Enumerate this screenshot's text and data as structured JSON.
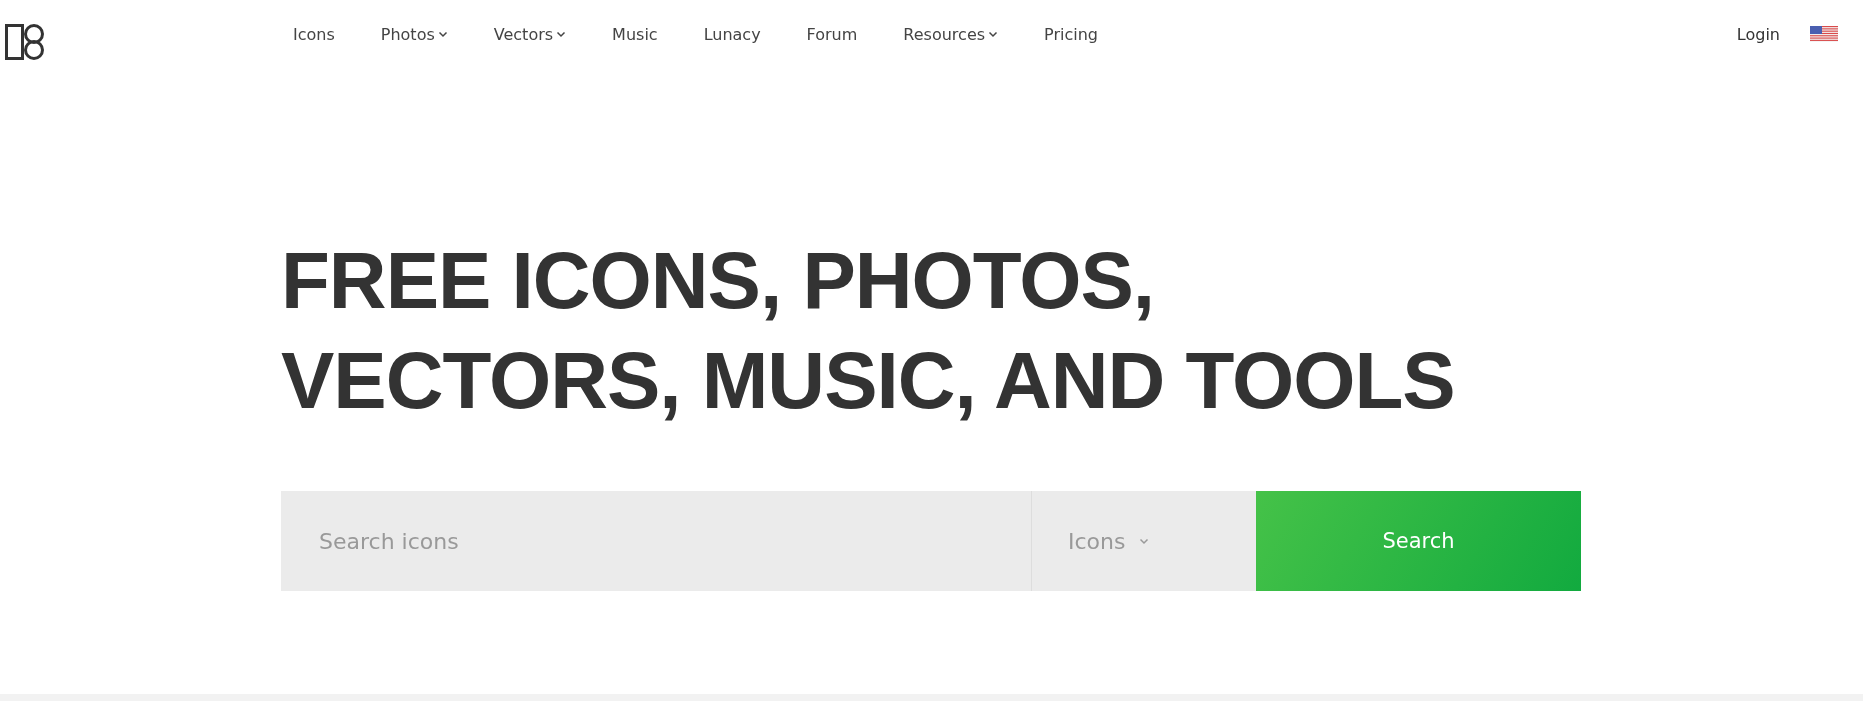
{
  "nav": [
    {
      "label": "Icons",
      "dropdown": false
    },
    {
      "label": "Photos",
      "dropdown": true
    },
    {
      "label": "Vectors",
      "dropdown": true
    },
    {
      "label": "Music",
      "dropdown": false
    },
    {
      "label": "Lunacy",
      "dropdown": false
    },
    {
      "label": "Forum",
      "dropdown": false
    },
    {
      "label": "Resources",
      "dropdown": true
    },
    {
      "label": "Pricing",
      "dropdown": false
    }
  ],
  "login": "Login",
  "headline": [
    "FREE ICONS, PHOTOS,",
    "VECTORS, MUSIC, AND TOOLS"
  ],
  "search": {
    "placeholder": "Search icons",
    "category": "Icons",
    "button": "Search"
  }
}
